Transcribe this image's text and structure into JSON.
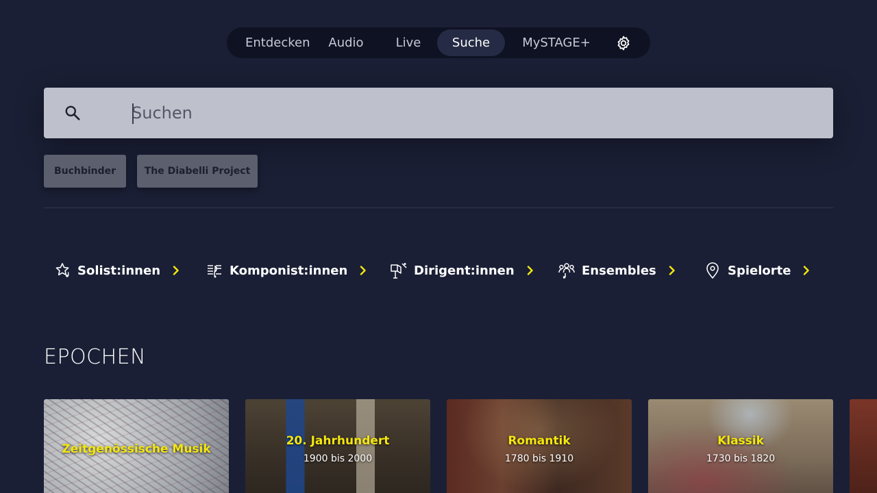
{
  "nav": {
    "items": [
      {
        "label": "Entdecken"
      },
      {
        "label": "Audio"
      },
      {
        "label": "Live"
      },
      {
        "label": "Suche",
        "active": true
      },
      {
        "label": "MySTAGE+"
      }
    ],
    "settings_icon": "gear-icon"
  },
  "search": {
    "placeholder": "Suchen",
    "value": "",
    "icon": "search-icon"
  },
  "recent_searches": [
    {
      "label": "Buchbinder"
    },
    {
      "label": "The Diabelli Project"
    }
  ],
  "categories": [
    {
      "label": "Solist:innen",
      "icon": "star-music-icon"
    },
    {
      "label": "Komponist:innen",
      "icon": "sheet-music-icon"
    },
    {
      "label": "Dirigent:innen",
      "icon": "conductor-stand-icon"
    },
    {
      "label": "Ensembles",
      "icon": "group-icon"
    },
    {
      "label": "Spielorte",
      "icon": "location-pin-icon"
    }
  ],
  "epochs": {
    "title": "EPOCHEN",
    "cards": [
      {
        "title": "Zeitgenössische Musik",
        "subtitle": ""
      },
      {
        "title": "20. Jahrhundert",
        "subtitle": "1900 bis 2000"
      },
      {
        "title": "Romantik",
        "subtitle": "1780 bis 1910"
      },
      {
        "title": "Klassik",
        "subtitle": "1730 bis 1820"
      }
    ]
  },
  "colors": {
    "background": "#1a1f35",
    "accent": "#f5e70e",
    "nav_bg": "#0f1222",
    "search_bg": "#bec1cb",
    "chip_bg": "#5b5f6e"
  }
}
